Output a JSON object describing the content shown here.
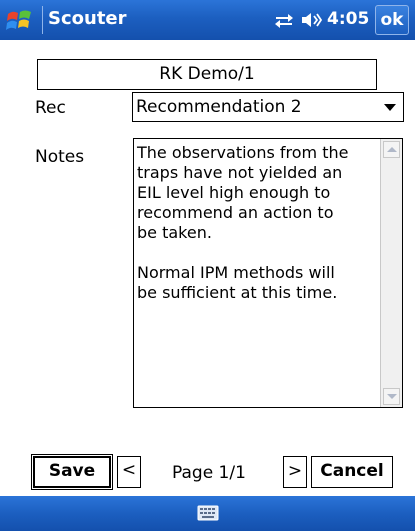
{
  "titlebar": {
    "app_title": "Scouter",
    "clock": "4:05",
    "ok_label": "ok",
    "icons": {
      "start": "windows-start-icon",
      "connectivity": "connectivity-arrows-icon",
      "volume": "speaker-volume-icon"
    }
  },
  "record": {
    "title": "RK Demo/1"
  },
  "form": {
    "rec_label": "Rec",
    "rec_value": "Recommendation 2",
    "notes_label": "Notes",
    "notes_value": "The observations from the\ntraps have not yielded an\nEIL level high enough to\nrecommend an action to\nbe taken.\n\nNormal IPM methods will\nbe sufficient at this time."
  },
  "nav": {
    "save_label": "Save",
    "prev_label": "<",
    "page_indicator": "Page 1/1",
    "next_label": ">",
    "cancel_label": "Cancel"
  },
  "menubar": {
    "keyboard_icon": "keyboard-icon"
  },
  "colors": {
    "titlebar_blue": "#1c5fc0",
    "menubar_blue": "#1c5fc0",
    "scrollbar_gray": "#f0f0f0"
  }
}
